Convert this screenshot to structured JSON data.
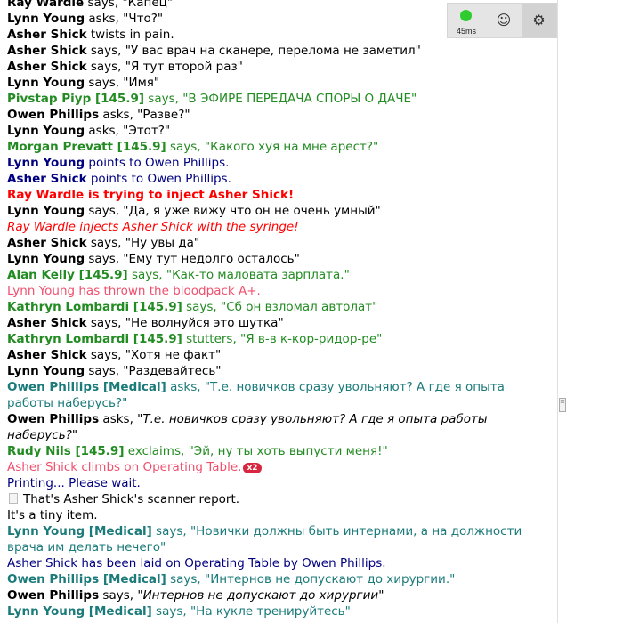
{
  "status_panel": {
    "ping_text": "45ms",
    "ping_color": "#2ecc2e",
    "emote_icon": "smiley-icon",
    "settings_icon": "gear-icon"
  },
  "colors": {
    "radio_green": "#228b22",
    "radio_teal": "#1b7a7a",
    "emote_navy": "#000080",
    "alert_red": "#ff0000",
    "warning_pink": "#f0506e",
    "badge_red": "#d7263d"
  },
  "chat": [
    {
      "name": "Ray Wardle",
      "text": " says, \"Капец\""
    },
    {
      "name": "Lynn Young",
      "text": " asks, \"Что?\""
    },
    {
      "name": "Asher Shick",
      "text": " twists in pain."
    },
    {
      "name": "Asher Shick",
      "text": " says, \"У вас врач на сканере, перелома не заметил\""
    },
    {
      "name": "Asher Shick",
      "text": " says, \"Я тут второй раз\""
    },
    {
      "name": "Lynn Young",
      "text": " says, \"Имя\""
    },
    {
      "name": "Pivstap Piyp [145.9]",
      "text": " says, \"В ЭФИРЕ ПЕРЕДАЧА СПОРЫ О ДАЧЕ\""
    },
    {
      "name": "Owen Phillips",
      "text": " asks, \"Разве?\""
    },
    {
      "name": "Lynn Young",
      "text": " asks, \"Этот?\""
    },
    {
      "name": "Morgan Prevatt [145.9]",
      "text": " says, \"Какого хуя на мне арест?\""
    },
    {
      "name": "Lynn Young",
      "text": " points to Owen Phillips."
    },
    {
      "name": "Asher Shick",
      "text": " points to Owen Phillips."
    },
    {
      "text": "Ray Wardle is trying to inject Asher Shick!"
    },
    {
      "name": "Lynn Young",
      "text": " says, \"Да, я уже вижу что он не очень умный\""
    },
    {
      "text": "Ray Wardle injects Asher Shick with the syringe!"
    },
    {
      "name": "Asher Shick",
      "text": " says, \"Ну увы да\""
    },
    {
      "name": "Lynn Young",
      "text": " says, \"Ему тут недолго осталось\""
    },
    {
      "name": "Alan Kelly [145.9]",
      "text": " says, \"Как-то маловата зарплата.\""
    },
    {
      "text": "Lynn Young has thrown the bloodpack A+."
    },
    {
      "name": "Kathryn Lombardi [145.9]",
      "text": " says, \"Сб он взломал автолат\""
    },
    {
      "name": "Asher Shick",
      "text": " says, \"Не волнуйся это шутка\""
    },
    {
      "name": "Kathryn Lombardi [145.9]",
      "text": " stutters, \"Я в-в к-кор-ридор-ре\""
    },
    {
      "name": "Asher Shick",
      "text": " says, \"Хотя не факт\""
    },
    {
      "name": "Lynn Young",
      "text": " says, \"Раздевайтесь\""
    },
    {
      "name": "Owen Phillips [Medical]",
      "text": " asks, \"Т.е. новичков сразу увольняют? А где я опыта работы наберусь?\""
    },
    {
      "name": "Owen Phillips",
      "text_pre": " asks, \"",
      "text_italic": "Т.е. новичков сразу увольняют? А где я опыта работы наберусь?",
      "text_post": "\""
    },
    {
      "name": "Rudy Nils [145.9]",
      "text": " exclaims, \"Эй, ну ты хоть выпусти меня!\""
    },
    {
      "text": "Asher Shick climbs on Operating Table.",
      "badge": "x2"
    },
    {
      "text": "Printing... Please wait."
    },
    {
      "text": "That's Asher Shick's scanner report."
    },
    {
      "text": "It's a tiny item."
    },
    {
      "name": "Lynn Young [Medical]",
      "text": " says, \"Новички должны быть интернами, а на должности врача им делать нечего\""
    },
    {
      "text": "Asher Shick has been laid on Operating Table by Owen Phillips."
    },
    {
      "name": "Owen Phillips [Medical]",
      "text": " says, \"Интернов не допускают до хирургии.\""
    },
    {
      "name": "Owen Phillips",
      "text_pre": " says, \"",
      "text_italic": "Интернов не допускают до хирургии",
      "text_post": "\""
    },
    {
      "name": "Lynn Young [Medical]",
      "text": " says, \"На кукле тренируйтесь\""
    }
  ]
}
